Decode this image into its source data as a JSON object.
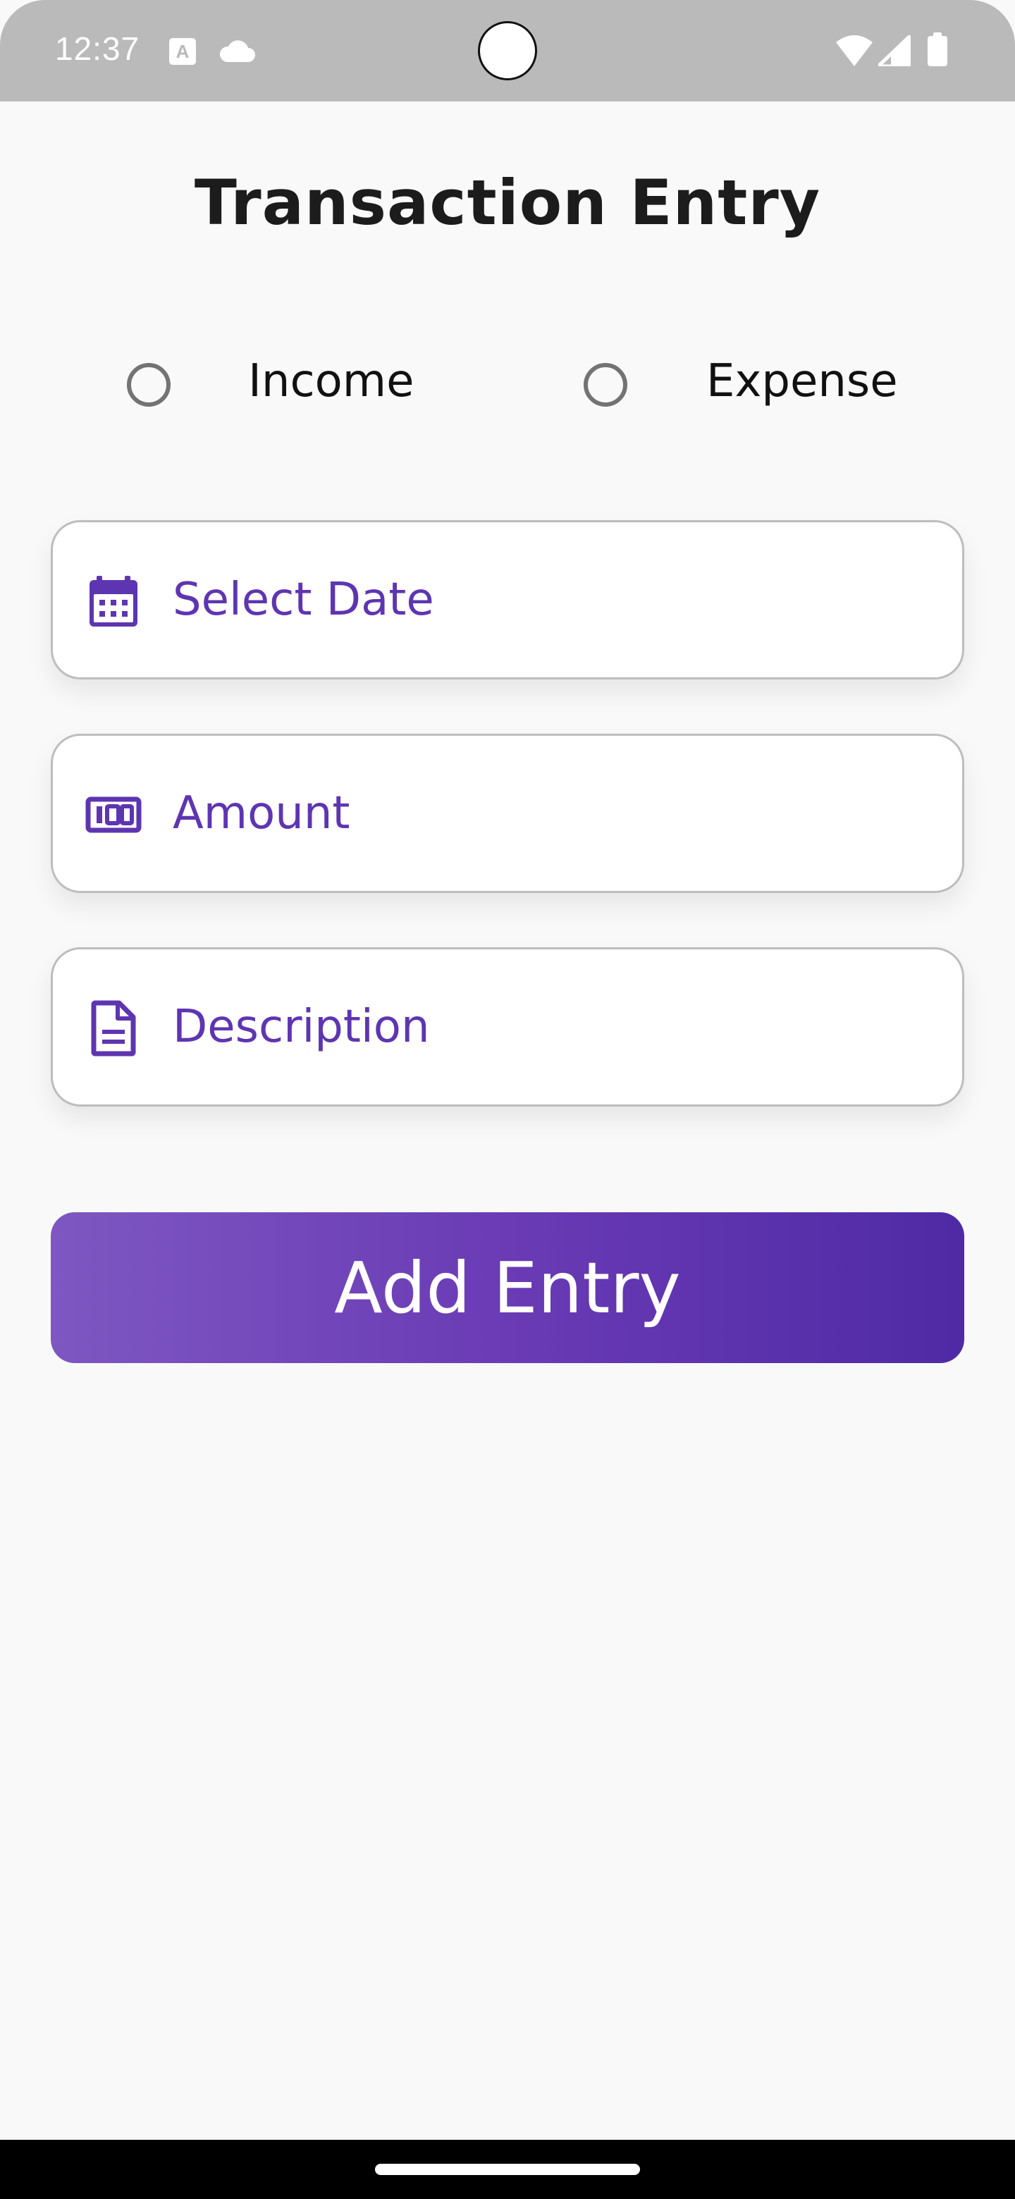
{
  "status_bar": {
    "time": "12:37",
    "left_icons": [
      "font-a-icon",
      "cloud-icon"
    ],
    "right_icons": [
      "wifi-icon",
      "cell-signal-icon",
      "battery-icon"
    ]
  },
  "page": {
    "title": "Transaction Entry"
  },
  "transaction_type": {
    "options": [
      {
        "label": "Income",
        "selected": false
      },
      {
        "label": "Expense",
        "selected": false
      }
    ]
  },
  "form": {
    "date": {
      "placeholder": "Select Date",
      "icon": "calendar-icon"
    },
    "amount": {
      "placeholder": "Amount",
      "icon": "money-icon"
    },
    "description": {
      "placeholder": "Description",
      "icon": "document-icon"
    }
  },
  "actions": {
    "add_label": "Add Entry"
  },
  "colors": {
    "accent": "#5e35b1",
    "button_gradient_start": "#7e57c2",
    "button_gradient_end": "#4f2aa5",
    "background": "#f9f9f9",
    "status_bar": "#bababa"
  }
}
